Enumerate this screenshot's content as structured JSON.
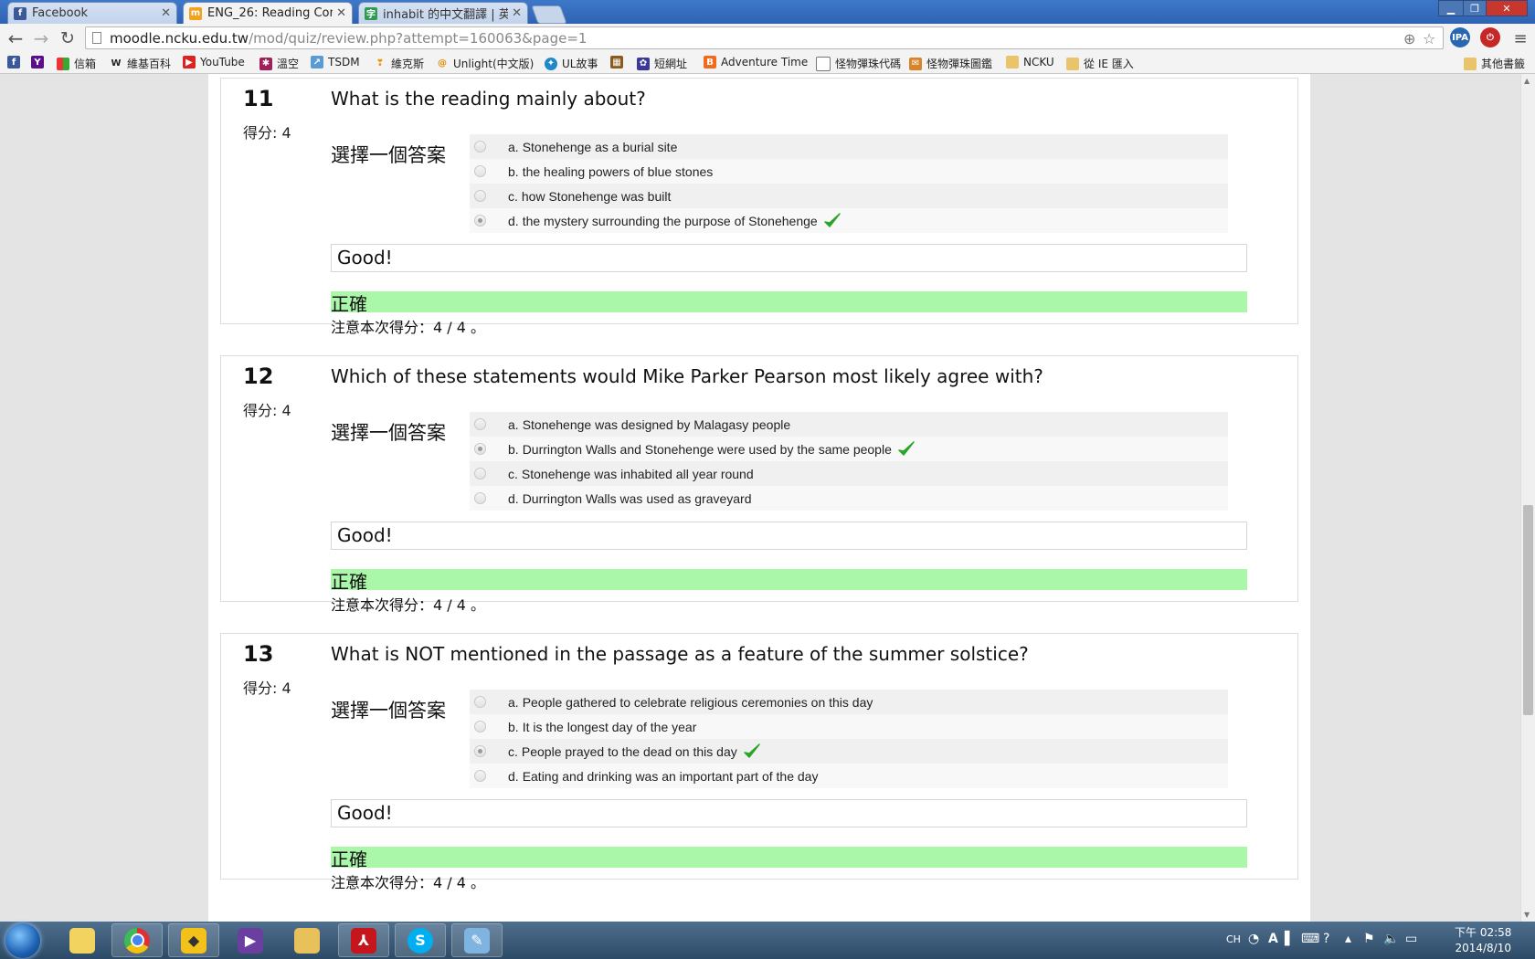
{
  "browser": {
    "tabs": [
      {
        "title": "Facebook",
        "active": false
      },
      {
        "title": "ENG_26: Reading Comp",
        "active": true
      },
      {
        "title": "inhabit 的中文翻譯 | 英漢",
        "active": false
      }
    ],
    "url_host": "moodle.ncku.edu.tw",
    "url_path": "/mod/quiz/review.php?attempt=160063&page=1",
    "bookmarks": [
      "信箱",
      "維基百科",
      "YouTube",
      "溫空",
      "TSDM",
      "維克斯",
      "Unlight(中文版)",
      "UL故事",
      "短網址",
      "Adventure Time",
      "怪物彈珠代碼",
      "怪物彈珠圖鑑",
      "NCKU",
      "從 IE 匯入"
    ],
    "other_bookmarks": "其他書籤"
  },
  "quiz": {
    "prompt_label": "選擇一個答案",
    "questions": [
      {
        "number": "11",
        "grade": "得分: 4",
        "text": "What is the reading mainly about?",
        "options": [
          {
            "letter": "a.",
            "text": "Stonehenge as a burial site",
            "selected": false
          },
          {
            "letter": "b.",
            "text": "the healing powers of blue stones",
            "selected": false
          },
          {
            "letter": "c.",
            "text": "how Stonehenge was built",
            "selected": false
          },
          {
            "letter": "d.",
            "text": "the mystery surrounding the purpose of Stonehenge",
            "selected": true
          }
        ],
        "feedback": "Good!",
        "status": "正確",
        "score_note": "注意本次得分：4 / 4 。"
      },
      {
        "number": "12",
        "grade": "得分: 4",
        "text": "Which of these statements would Mike Parker Pearson most likely agree with?",
        "options": [
          {
            "letter": "a.",
            "text": "Stonehenge was designed by Malagasy people",
            "selected": false
          },
          {
            "letter": "b.",
            "text": "Durrington Walls and Stonehenge were used by the same people",
            "selected": true
          },
          {
            "letter": "c.",
            "text": "Stonehenge was inhabited all year round",
            "selected": false
          },
          {
            "letter": "d.",
            "text": "Durrington Walls was used as graveyard",
            "selected": false
          }
        ],
        "feedback": "Good!",
        "status": "正確",
        "score_note": "注意本次得分：4 / 4 。"
      },
      {
        "number": "13",
        "grade": "得分: 4",
        "text": "What is NOT mentioned in the passage as a feature of the summer solstice?",
        "options": [
          {
            "letter": "a.",
            "text": "People gathered to celebrate religious ceremonies on this day",
            "selected": false
          },
          {
            "letter": "b.",
            "text": "It is the longest day of the year",
            "selected": false
          },
          {
            "letter": "c.",
            "text": "People prayed to the dead on this day",
            "selected": true
          },
          {
            "letter": "d.",
            "text": "Eating and drinking was an important part of the day",
            "selected": false
          }
        ],
        "feedback": "Good!",
        "status": "正確",
        "score_note": "注意本次得分：4 / 4 。"
      }
    ]
  },
  "taskbar": {
    "language": "CH",
    "time": "下午 02:58",
    "date": "2014/8/10"
  },
  "colors": {
    "correct_bg": "#aaf7aa",
    "tick": "#2aa52a",
    "taskbar": "#2c4a66"
  }
}
